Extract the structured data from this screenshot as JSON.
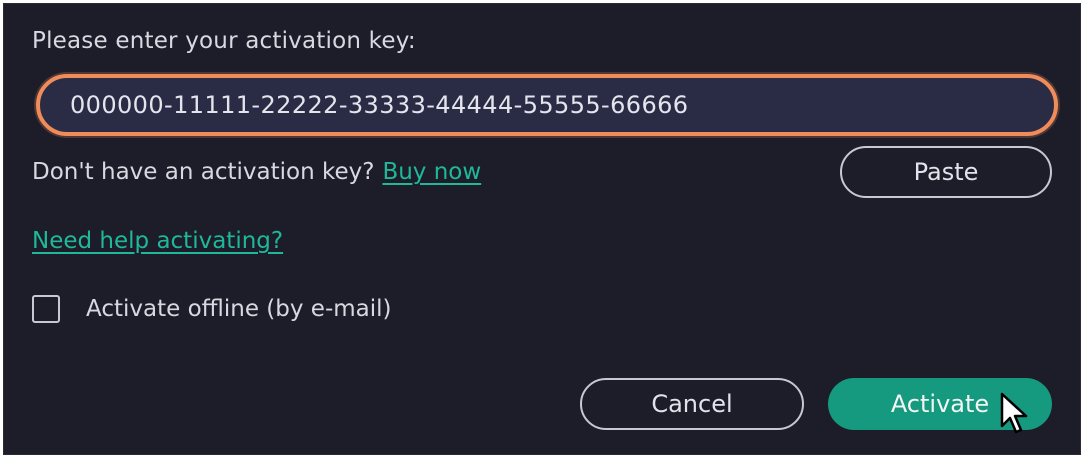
{
  "dialog": {
    "prompt": "Please enter your activation key:",
    "key_value": "000000-11111-22222-33333-44444-55555-66666",
    "no_key_text": "Don't have an activation key?",
    "buy_now": "Buy now",
    "paste_label": "Paste",
    "help_link": "Need help activating?",
    "offline_label": "Activate offline (by e-mail)",
    "offline_checked": false,
    "cancel_label": "Cancel",
    "activate_label": "Activate"
  },
  "colors": {
    "background": "#1c1d28",
    "accent": "#15997f",
    "link": "#1fb89a",
    "focus_border": "#f08c5a"
  },
  "icons": {
    "cursor": "mouse-pointer-icon"
  }
}
